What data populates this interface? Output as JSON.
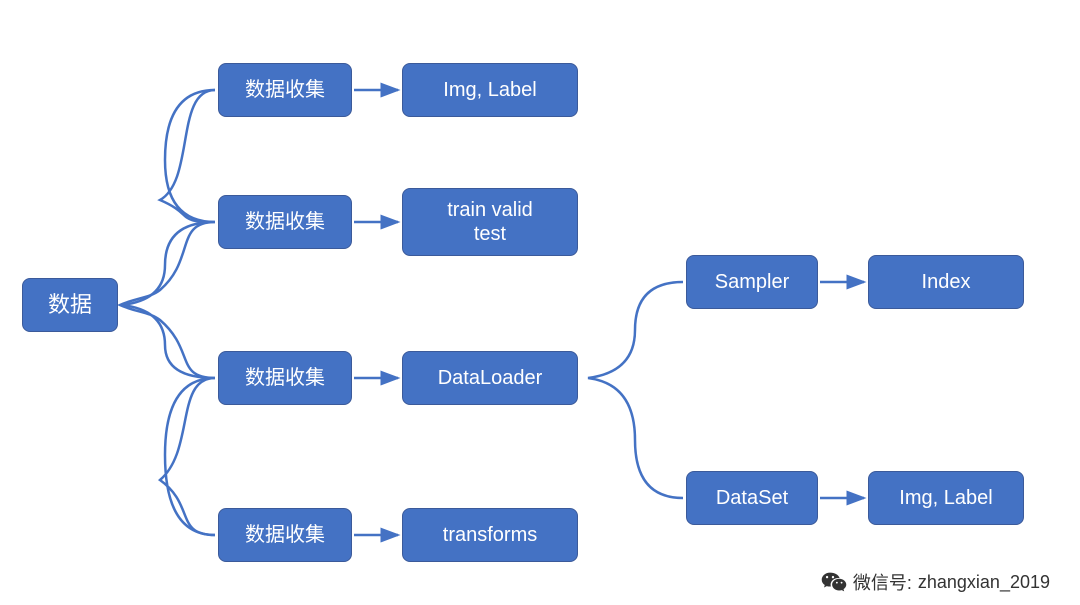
{
  "root": {
    "label": "数据"
  },
  "level2": {
    "a": {
      "label": "数据收集",
      "leaf": "Img, Label"
    },
    "b": {
      "label": "数据收集",
      "leaf": "train valid\ntest"
    },
    "c": {
      "label": "数据收集",
      "leaf": "DataLoader"
    },
    "d": {
      "label": "数据收集",
      "leaf": "transforms"
    }
  },
  "level3": {
    "sampler": {
      "label": "Sampler",
      "leaf": "Index"
    },
    "dataset": {
      "label": "DataSet",
      "leaf": "Img, Label"
    }
  },
  "watermark": {
    "prefix": "微信号:",
    "handle": "zhangxian_2019"
  }
}
